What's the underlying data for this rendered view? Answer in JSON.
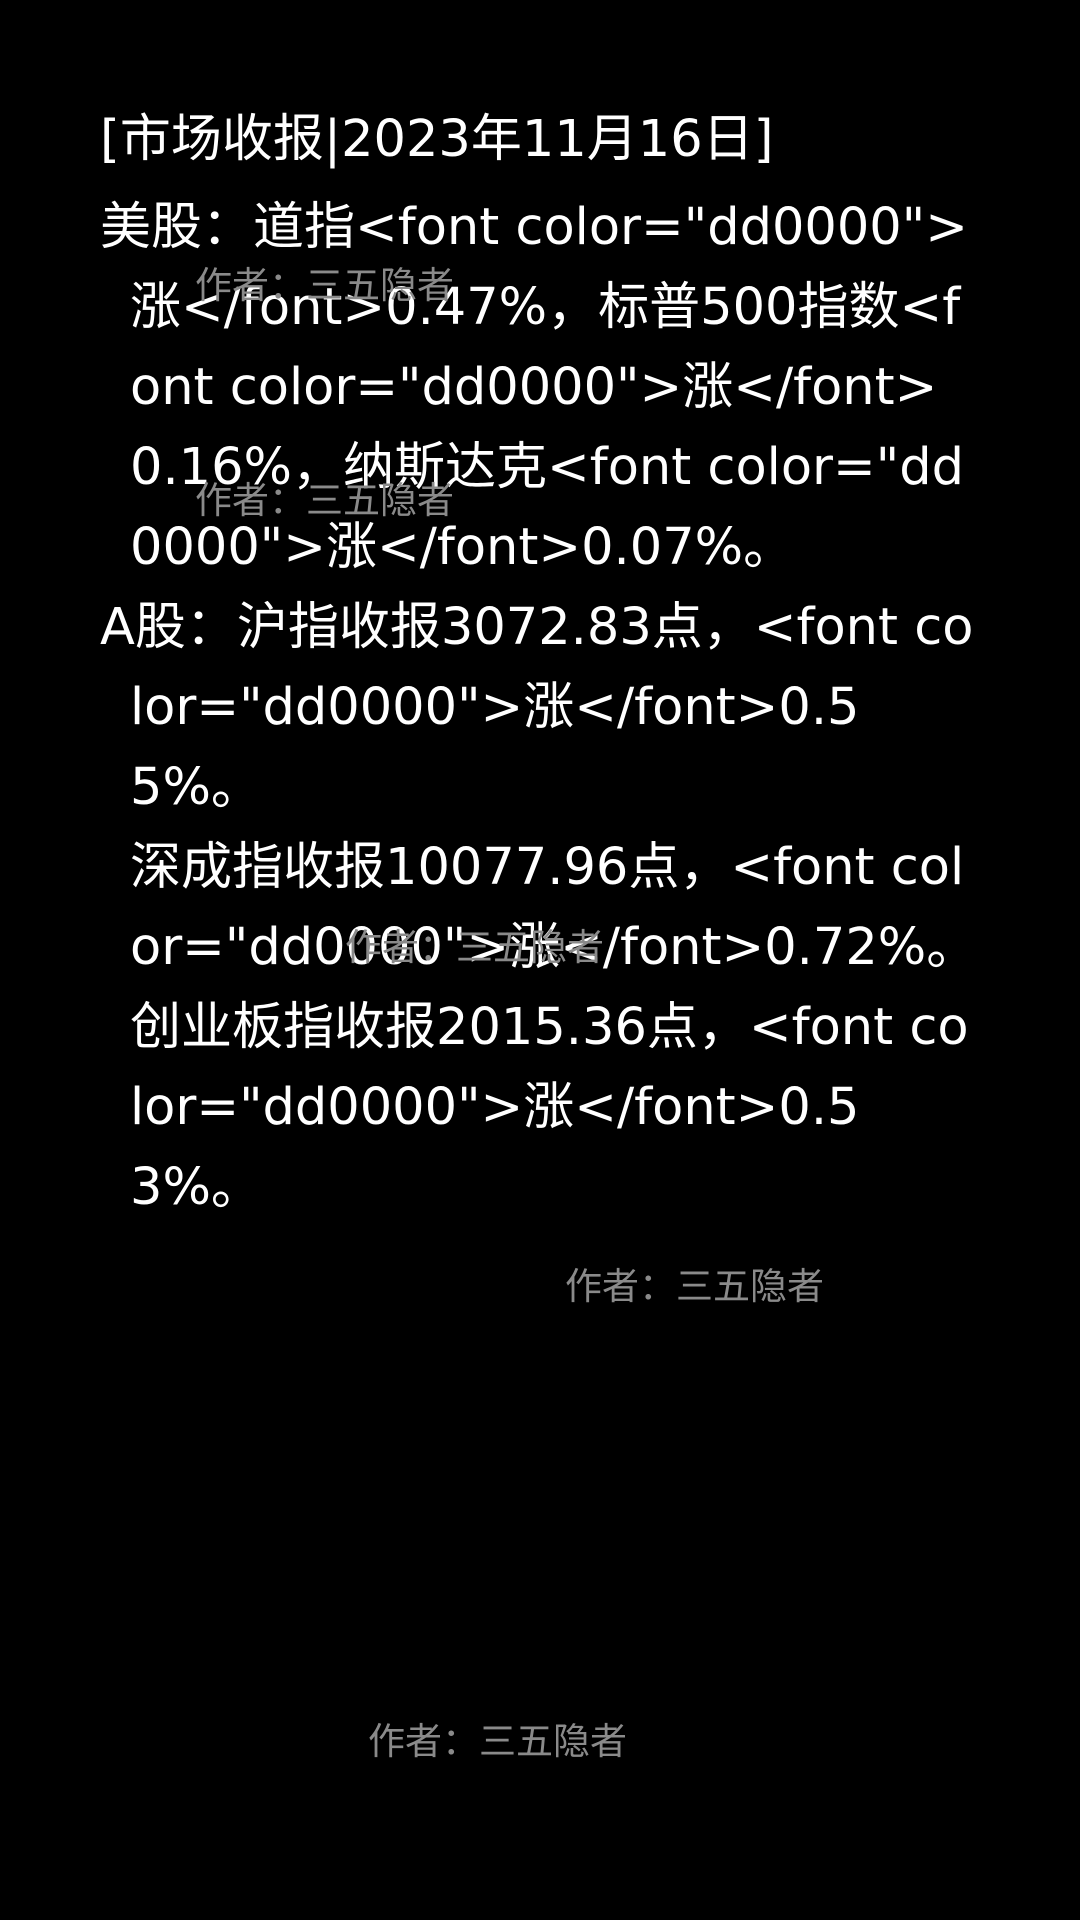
{
  "report": {
    "title": "[市场收报|2023年11月16日]",
    "us_stocks": "美股：道指<font color=\"dd0000\">涨</font>0.47%，标普500指数<font color=\"dd0000\">涨</font>0.16%，纳斯达克<font color=\"dd0000\">涨</font>0.07%。",
    "a_shares": {
      "shanghai": "A股：沪指收报3072.83点，<font color=\"dd0000\">涨</font>0.55%。",
      "shenzhen": "深成指收报10077.96点，<font color=\"dd0000\">涨</font>0.72%。",
      "chinext": "创业板指收报2015.36点，<font color=\"dd0000\">涨</font>0.53%。"
    }
  },
  "watermark": {
    "text": "作者：三五隐者"
  },
  "colors": {
    "background": "#000000",
    "text": "#ffffff",
    "watermark": "#8a8a8a"
  }
}
